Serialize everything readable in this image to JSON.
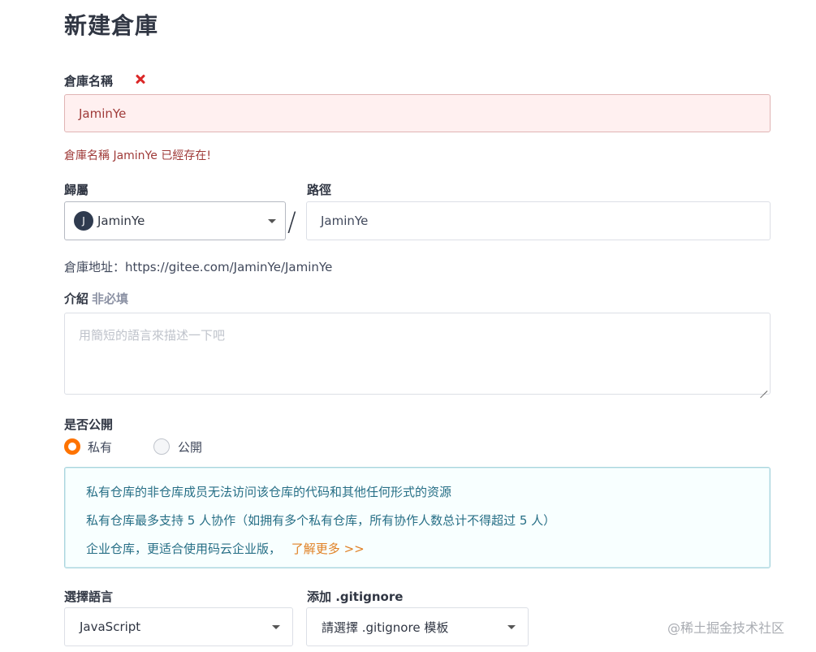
{
  "page": {
    "title": "新建倉庫"
  },
  "repo_name": {
    "label": "倉庫名稱",
    "value": "JaminYe",
    "error_message": "倉庫名稱 JaminYe 已經存在!"
  },
  "owner": {
    "label": "歸屬",
    "avatar_letter": "J",
    "value": "JaminYe"
  },
  "path": {
    "label": "路徑",
    "separator": "/",
    "value": "JaminYe"
  },
  "repo_address": "倉庫地址：https://gitee.com/JaminYe/JaminYe",
  "description": {
    "label": "介紹",
    "optional_tag": "非必填",
    "placeholder": "用簡短的語言來描述一下吧"
  },
  "visibility": {
    "label": "是否公開",
    "options": [
      {
        "label": "私有",
        "selected": true
      },
      {
        "label": "公開",
        "selected": false
      }
    ]
  },
  "info_box": {
    "line1": "私有仓库的非仓库成员无法访问该仓库的代码和其他任何形式的资源",
    "line2": "私有仓库最多支持 5 人协作（如拥有多个私有仓库，所有协作人数总计不得超过 5 人）",
    "line3": "企业仓库，更适合使用码云企业版，",
    "link": "了解更多 >>"
  },
  "language": {
    "label": "選擇語言",
    "value": "JavaScript"
  },
  "gitignore": {
    "label": "添加 .gitignore",
    "value": "請選擇 .gitignore 模板"
  },
  "watermark": "@稀土掘金技术社区",
  "colors": {
    "accent": "#fe7300",
    "error": "#9f3a38",
    "info_text": "#276f86"
  }
}
